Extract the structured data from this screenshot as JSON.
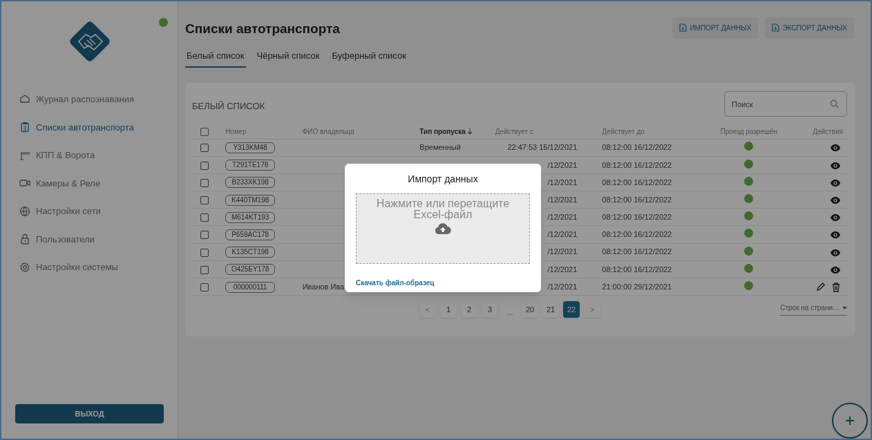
{
  "sidebar": {
    "online": true,
    "items": [
      {
        "label": "Журнал распознавания",
        "kind": "home",
        "selected": false
      },
      {
        "label": "Списки автотранспорта",
        "kind": "lists",
        "selected": true
      },
      {
        "label": "КПП & Ворота",
        "kind": "gates",
        "selected": false
      },
      {
        "label": "Камеры & Реле",
        "kind": "cameras",
        "selected": false
      },
      {
        "label": "Настройки сети",
        "kind": "network",
        "selected": false
      },
      {
        "label": "Пользователи",
        "kind": "users",
        "selected": false
      },
      {
        "label": "Настройки системы",
        "kind": "settings",
        "selected": false
      }
    ],
    "logout": "ВЫХОД"
  },
  "page": {
    "title": "Списки автотранспорта",
    "actions": [
      "ИМПОРТ ДАННЫХ",
      "ЭКСПОРТ ДАННЫХ"
    ],
    "tabs": [
      {
        "label": "Белый список",
        "selected": true
      },
      {
        "label": "Чёрный список",
        "selected": false
      },
      {
        "label": "Буферный список",
        "selected": false
      }
    ]
  },
  "card": {
    "title": "БЕЛЫЙ СПИСОК",
    "search": {
      "placeholder": "Поиск"
    },
    "select_all": {
      "checked": false
    },
    "columns": [
      {
        "label": "Номер",
        "sorted": false
      },
      {
        "label": "ФИО владельца",
        "sorted": false
      },
      {
        "label": "Тип пропуска",
        "sorted": true
      },
      {
        "label": "Действует с",
        "sorted": false
      },
      {
        "label": "Действует до",
        "sorted": false
      },
      {
        "label": "Проезд разрешён",
        "sorted": false
      },
      {
        "label": "Действия",
        "sorted": false
      }
    ],
    "rows": [
      {
        "checked": false,
        "plate": "Y313KM48",
        "type": "Временный",
        "valid_from": "22:47:53 15/12/2021",
        "valid_to": "08:12:00 16/12/2022",
        "allowed": true,
        "kind": "view"
      },
      {
        "checked": false,
        "plate": "T291TE178",
        "valid_from": "/12/2021",
        "valid_to": "08:12:00 16/12/2022",
        "allowed": true,
        "kind": "view"
      },
      {
        "checked": false,
        "plate": "B233XK198",
        "valid_from": "/12/2021",
        "valid_to": "08:12:00 16/12/2022",
        "allowed": true,
        "kind": "view"
      },
      {
        "checked": false,
        "plate": "K440TM198",
        "valid_from": "/12/2021",
        "valid_to": "08:12:00 16/12/2022",
        "allowed": true,
        "kind": "view"
      },
      {
        "checked": false,
        "plate": "M614KT193",
        "valid_from": "/12/2021",
        "valid_to": "08:12:00 16/12/2022",
        "allowed": true,
        "kind": "view"
      },
      {
        "checked": false,
        "plate": "P659AC178",
        "valid_from": "/12/2021",
        "valid_to": "08:12:00 16/12/2022",
        "allowed": true,
        "kind": "view"
      },
      {
        "checked": false,
        "plate": "K135CT198",
        "valid_from": "/12/2021",
        "valid_to": "08:12:00 16/12/2022",
        "allowed": true,
        "kind": "view"
      },
      {
        "checked": false,
        "plate": "O425EY178",
        "valid_from": "/12/2021",
        "valid_to": "08:12:00 16/12/2022",
        "allowed": true,
        "kind": "view"
      },
      {
        "checked": false,
        "plate": "000000111",
        "owner": "Иванов Ива",
        "valid_from": "/12/2021",
        "valid_to": "21:00:00 29/12/2021",
        "allowed": true,
        "kind": "edit"
      }
    ],
    "pagination": [
      {
        "label": "<",
        "kind": "arrow",
        "selected": false
      },
      {
        "label": "1",
        "kind": "page",
        "selected": false
      },
      {
        "label": "2",
        "kind": "page",
        "selected": false
      },
      {
        "label": "3",
        "kind": "page",
        "selected": false
      },
      {
        "label": "...",
        "kind": "gap"
      },
      {
        "label": "20",
        "kind": "page",
        "selected": false
      },
      {
        "label": "21",
        "kind": "page",
        "selected": false
      },
      {
        "label": "22",
        "kind": "page",
        "selected": true
      },
      {
        "label": ">",
        "kind": "arrow",
        "selected": false
      }
    ],
    "rows_per_page": "Строк на страни…"
  },
  "modal": {
    "title": "Импорт данных",
    "dropzone": "Нажмите или перетащите Excel-файл",
    "link": "Скачать файл-образец"
  }
}
